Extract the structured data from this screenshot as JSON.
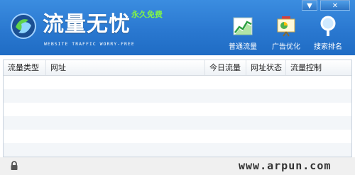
{
  "app": {
    "title": "流量无忧",
    "subtitle": "WEBSITE TRAFFIC WORRY-FREE",
    "badge": "永久免费"
  },
  "window_controls": {
    "minimize": "▼",
    "close": "✕"
  },
  "toolbar": [
    {
      "label": "普通流量",
      "icon": "traffic-chart-icon"
    },
    {
      "label": "广告优化",
      "icon": "presentation-board-icon"
    },
    {
      "label": "搜索排名",
      "icon": "search-magnifier-icon"
    }
  ],
  "table": {
    "columns": [
      "流量类型",
      "网址",
      "今日流量",
      "网址状态",
      "流量控制"
    ],
    "rows": []
  },
  "footer": {
    "watermark": "www.arpun.com",
    "lock_icon": "lock-icon"
  },
  "colors": {
    "header_blue": "#2a78d0",
    "badge_green": "#7ff24a"
  }
}
